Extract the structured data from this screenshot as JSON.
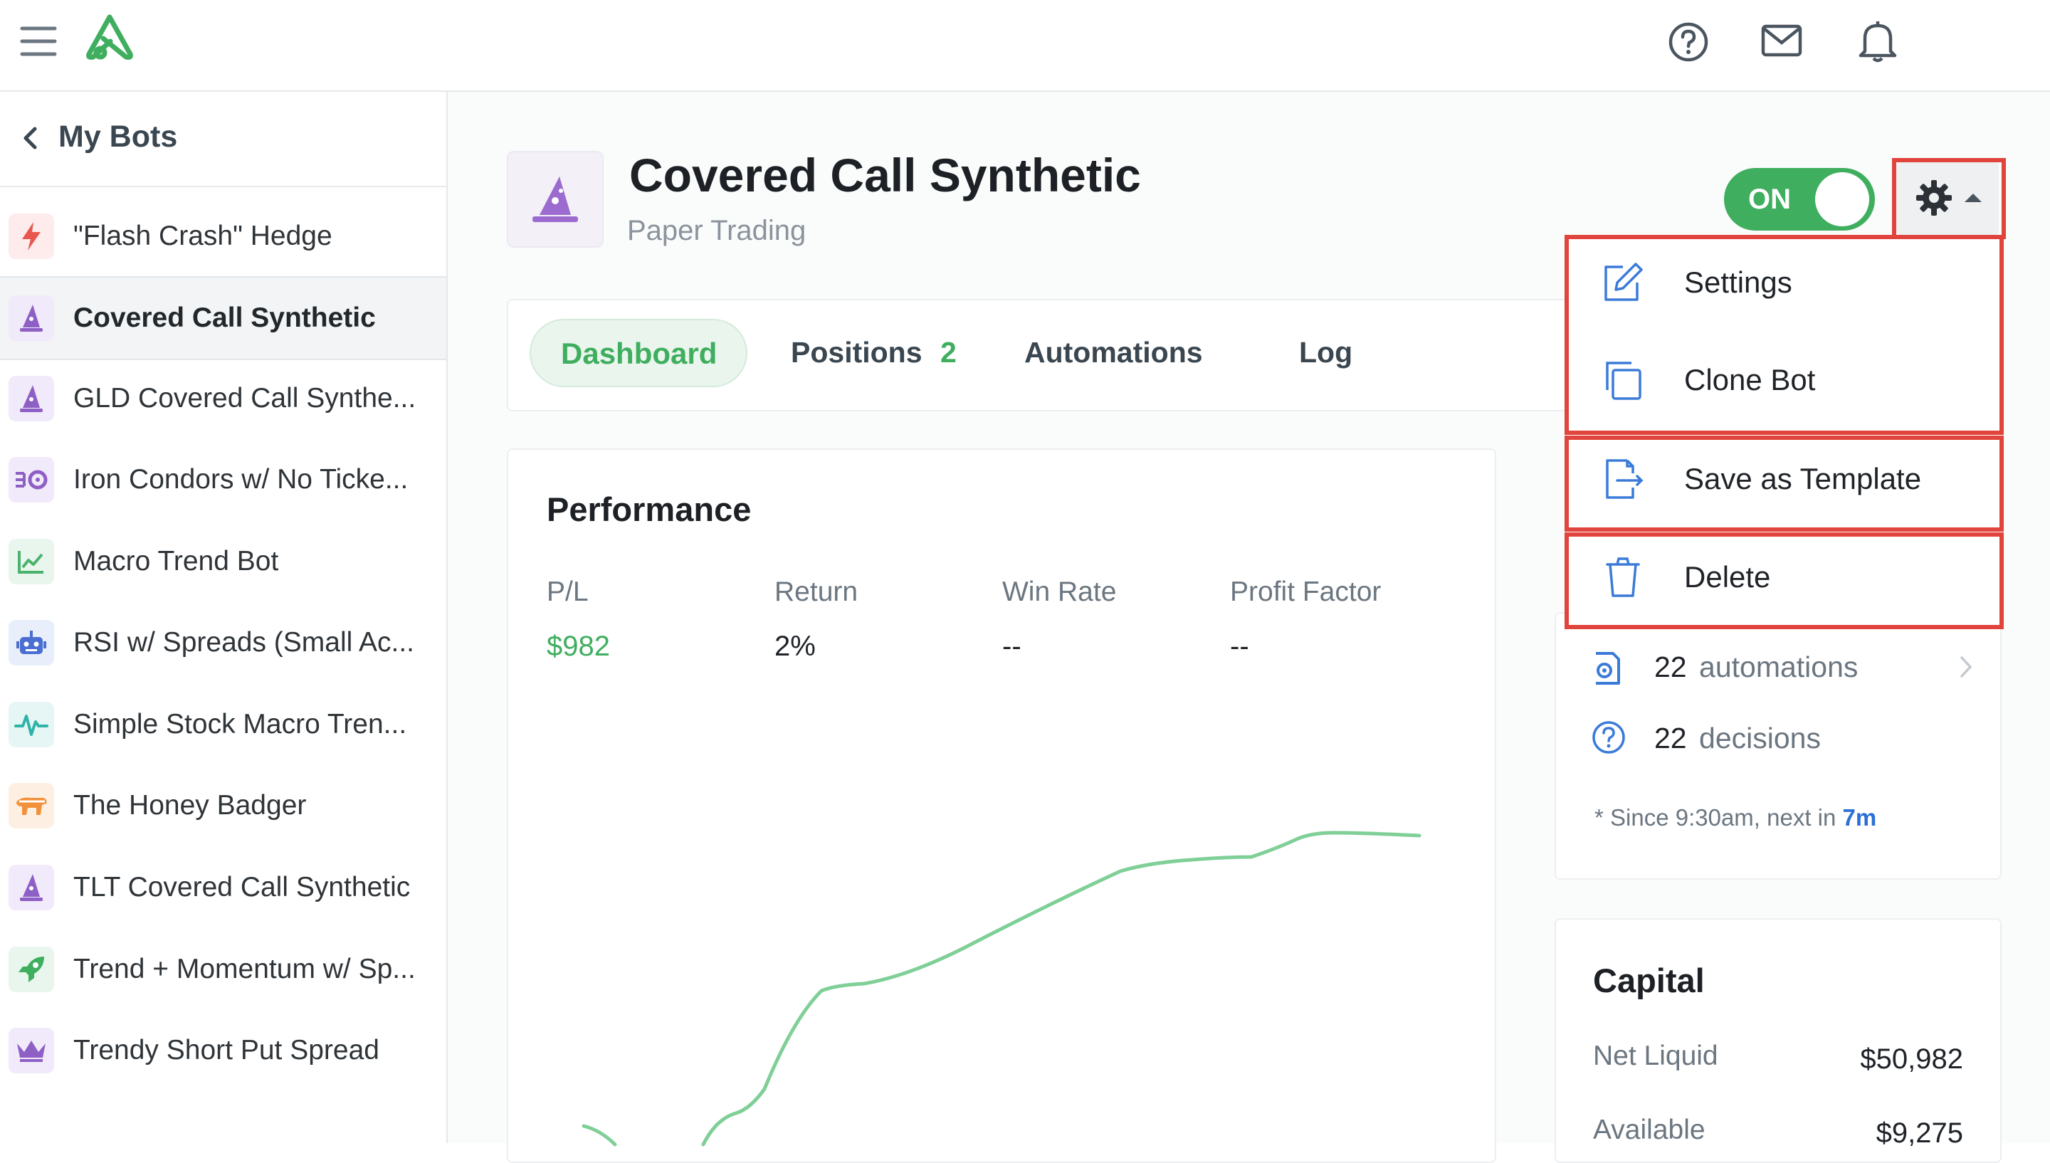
{
  "topbar": {
    "icons": [
      "menu-icon",
      "logo-icon",
      "help-icon",
      "mail-icon",
      "bell-icon"
    ]
  },
  "sidebar": {
    "back_label": "My Bots",
    "items": [
      {
        "label": "\"Flash Crash\" Hedge",
        "icon": "lightning-icon",
        "color": "#e8574f"
      },
      {
        "label": "Covered Call Synthetic",
        "icon": "wizard-hat-icon",
        "color": "#8e5fc4"
      },
      {
        "label": "GLD Covered Call Synthe...",
        "icon": "wizard-hat-icon",
        "color": "#8e5fc4"
      },
      {
        "label": "Iron Condors w/ No Ticke...",
        "icon": "condor-icon",
        "color": "#8e5fc4"
      },
      {
        "label": "Macro Trend Bot",
        "icon": "trend-chart-icon",
        "color": "#4bb26d"
      },
      {
        "label": "RSI w/ Spreads (Small Ac...",
        "icon": "robot-icon",
        "color": "#4a6fd1"
      },
      {
        "label": "Simple Stock Macro Tren...",
        "icon": "pulse-icon",
        "color": "#2fb3a8"
      },
      {
        "label": "The Honey Badger",
        "icon": "badger-icon",
        "color": "#f2913b"
      },
      {
        "label": "TLT Covered Call Synthetic",
        "icon": "wizard-hat-icon",
        "color": "#8e5fc4"
      },
      {
        "label": "Trend + Momentum w/ Sp...",
        "icon": "rocket-icon",
        "color": "#3fae5e"
      },
      {
        "label": "Trendy Short Put Spread",
        "icon": "crown-icon",
        "color": "#8e5fc4"
      }
    ]
  },
  "bot": {
    "title": "Covered Call Synthetic",
    "subtitle": "Paper Trading",
    "toggle": "ON"
  },
  "tabs": [
    {
      "label": "Dashboard"
    },
    {
      "label": "Positions",
      "badge": "2"
    },
    {
      "label": "Automations"
    },
    {
      "label": "Log"
    }
  ],
  "performance": {
    "title": "Performance",
    "stats": [
      {
        "label": "P/L",
        "value": "$982"
      },
      {
        "label": "Return",
        "value": "2%"
      },
      {
        "label": "Win Rate",
        "value": "--"
      },
      {
        "label": "Profit Factor",
        "value": "--"
      }
    ],
    "line_color": "#7fcf97"
  },
  "activity": {
    "automations_count": "22",
    "automations_label": "automations",
    "decisions_count": "22",
    "decisions_label": "decisions",
    "note_prefix": "* Since 9:30am, next in ",
    "note_highlight": "7m"
  },
  "capital": {
    "title": "Capital",
    "rows": [
      {
        "label": "Net Liquid",
        "value": "$50,982"
      },
      {
        "label": "Available",
        "value": "$9,275"
      }
    ]
  },
  "menu": {
    "items": [
      {
        "label": "Settings",
        "icon": "edit-icon"
      },
      {
        "label": "Clone Bot",
        "icon": "copy-icon"
      },
      {
        "label": "Save as Template",
        "icon": "export-file-icon"
      },
      {
        "label": "Delete",
        "icon": "trash-icon"
      }
    ]
  },
  "colors": {
    "accent_green": "#3fae5e",
    "highlight_red": "#e0443c",
    "link_blue": "#2b6fd6",
    "purple": "#8e5fc4"
  }
}
